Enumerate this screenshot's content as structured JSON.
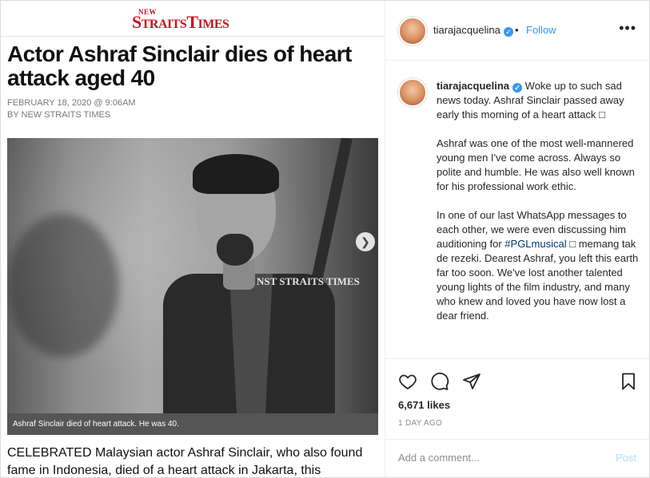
{
  "article": {
    "masthead_top": "NEW",
    "masthead_brand_a": "S",
    "masthead_brand_b": "TRAITS",
    "masthead_brand_c": "T",
    "masthead_brand_d": "IMES",
    "headline": "Actor Ashraf Sinclair dies of heart attack aged 40",
    "date": "FEBRUARY 18, 2020 @ 9:06AM",
    "byline": "BY NEW STRAITS TIMES",
    "watermark": "NST STRAITS TIMES",
    "caption": "Ashraf Sinclair died of heart attack. He was 40.",
    "lede": "CELEBRATED Malaysian actor Ashraf Sinclair, who also found fame in Indonesia, died of a heart attack in Jakarta, this"
  },
  "header": {
    "username": "tiarajacquelina",
    "verified_glyph": "✓",
    "separator": "•",
    "follow_label": "Follow",
    "more_glyph": "•••"
  },
  "caption": {
    "username": "tiarajacquelina",
    "p1": "Woke up to such sad news today. Ashraf Sinclair passed away early this morning of a heart attack □",
    "p2": "Ashraf was one of the most well-mannered young men I've come across. Always so polite and humble. He was also well known for his professional work ethic.",
    "p3_a": "In one of our last WhatsApp messages to each other, we were even discussing him auditioning for",
    "p3_hashtag": "#PGLmusical",
    "p3_b": "□ memang tak de rezeki. Dearest Ashraf, you left this earth far too soon. We've lost another talented young lights of the film industry, and many who knew and loved you have now lost a dear friend."
  },
  "actions": {
    "likes": "6,671 likes",
    "time_ago": "1 DAY AGO",
    "icons": [
      "heart-icon",
      "comment-icon",
      "share-icon",
      "bookmark-icon"
    ]
  },
  "comment_box": {
    "placeholder": "Add a comment...",
    "post_label": "Post"
  },
  "colors": {
    "link": "#3897f0",
    "brand_red": "#c4161c",
    "post_disabled": "#b2dffc"
  }
}
